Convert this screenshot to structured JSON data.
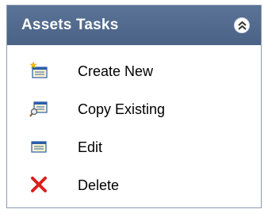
{
  "panel": {
    "title": "Assets Tasks",
    "collapse_icon": "double-chevron-up-icon"
  },
  "tasks": [
    {
      "label": "Create New",
      "icon": "new-record-icon"
    },
    {
      "label": "Copy Existing",
      "icon": "copy-record-icon"
    },
    {
      "label": "Edit",
      "icon": "edit-record-icon"
    },
    {
      "label": "Delete",
      "icon": "delete-x-icon"
    }
  ],
  "colors": {
    "header_bg": "#4f6a8f",
    "header_text": "#ffffff",
    "delete_red": "#d82020"
  }
}
